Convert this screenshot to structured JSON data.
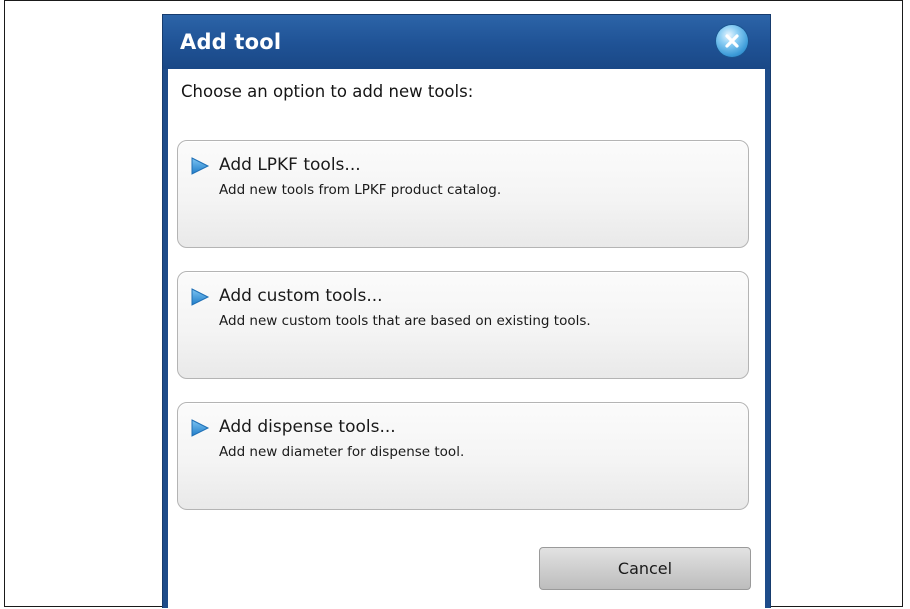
{
  "dialog": {
    "title": "Add tool",
    "close_icon": "close-icon",
    "prompt": "Choose an option to add new tools:",
    "options": [
      {
        "icon": "play-arrow-icon",
        "title": "Add LPKF tools...",
        "description": "Add new tools from LPKF product catalog."
      },
      {
        "icon": "play-arrow-icon",
        "title": "Add custom tools...",
        "description": "Add new custom tools that are based on existing tools."
      },
      {
        "icon": "play-arrow-icon",
        "title": "Add dispense tools...",
        "description": "Add new diameter for dispense tool."
      }
    ],
    "cancel_label": "Cancel"
  },
  "colors": {
    "title_bar": "#1f5295",
    "frame": "#1e4c8a",
    "arrow": "#2f8fd6",
    "close_button": "#3b9ad8"
  }
}
